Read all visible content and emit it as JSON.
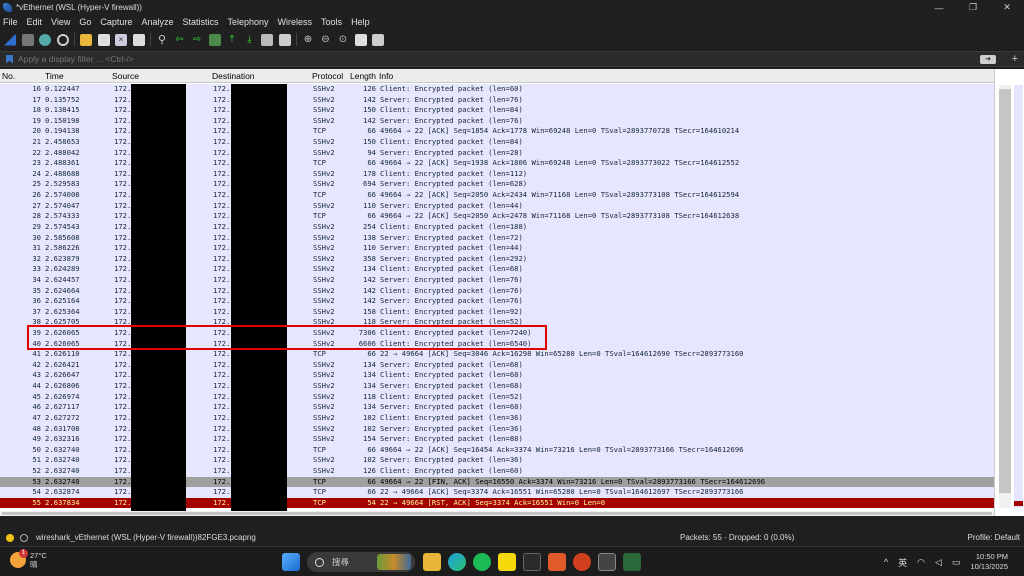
{
  "window": {
    "title": "*vEthernet (WSL (Hyper-V firewall))",
    "controls": [
      "—",
      "❐",
      "✕"
    ]
  },
  "menu": [
    "File",
    "Edit",
    "View",
    "Go",
    "Capture",
    "Analyze",
    "Statistics",
    "Telephony",
    "Wireless",
    "Tools",
    "Help"
  ],
  "filter": {
    "placeholder": "Apply a display filter ... <Ctrl-/>"
  },
  "columns": {
    "no": "No.",
    "time": "Time",
    "source": "Source",
    "destination": "Destination",
    "protocol": "Protocol",
    "length": "Length",
    "info": "Info"
  },
  "packets": [
    {
      "no": "16",
      "time": "0.122447",
      "src": "172.",
      "dst": "172.",
      "proto": "SSHv2",
      "len": "126",
      "info": "Client: Encrypted packet (len=60)"
    },
    {
      "no": "17",
      "time": "0.135752",
      "src": "172.",
      "dst": "172.",
      "proto": "SSHv2",
      "len": "142",
      "info": "Server: Encrypted packet (len=76)"
    },
    {
      "no": "18",
      "time": "0.138415",
      "src": "172.",
      "dst": "172.",
      "proto": "SSHv2",
      "len": "150",
      "info": "Client: Encrypted packet (len=84)"
    },
    {
      "no": "19",
      "time": "0.150198",
      "src": "172.",
      "dst": "172.",
      "proto": "SSHv2",
      "len": "142",
      "info": "Server: Encrypted packet (len=76)"
    },
    {
      "no": "20",
      "time": "0.194138",
      "src": "172.",
      "dst": "172.",
      "proto": "TCP",
      "len": "66",
      "info": "49664 → 22 [ACK] Seq=1854 Ack=1778 Win=69248 Len=0 TSval=2893770728 TSecr=164610214"
    },
    {
      "no": "21",
      "time": "2.458653",
      "src": "172.",
      "dst": "172.",
      "proto": "SSHv2",
      "len": "150",
      "info": "Client: Encrypted packet (len=84)"
    },
    {
      "no": "22",
      "time": "2.488042",
      "src": "172.",
      "dst": "172.",
      "proto": "SSHv2",
      "len": "94",
      "info": "Server: Encrypted packet (len=28)"
    },
    {
      "no": "23",
      "time": "2.488361",
      "src": "172.",
      "dst": "172.",
      "proto": "TCP",
      "len": "66",
      "info": "49664 → 22 [ACK] Seq=1938 Ack=1806 Win=69248 Len=0 TSval=2893773022 TSecr=164612552"
    },
    {
      "no": "24",
      "time": "2.488688",
      "src": "172.",
      "dst": "172.",
      "proto": "SSHv2",
      "len": "178",
      "info": "Client: Encrypted packet (len=112)"
    },
    {
      "no": "25",
      "time": "2.529583",
      "src": "172.",
      "dst": "172.",
      "proto": "SSHv2",
      "len": "694",
      "info": "Server: Encrypted packet (len=628)"
    },
    {
      "no": "26",
      "time": "2.574008",
      "src": "172.",
      "dst": "172.",
      "proto": "TCP",
      "len": "66",
      "info": "49664 → 22 [ACK] Seq=2050 Ack=2434 Win=71168 Len=0 TSval=2893773108 TSecr=164612594"
    },
    {
      "no": "27",
      "time": "2.574047",
      "src": "172.",
      "dst": "172.",
      "proto": "SSHv2",
      "len": "110",
      "info": "Server: Encrypted packet (len=44)"
    },
    {
      "no": "28",
      "time": "2.574333",
      "src": "172.",
      "dst": "172.",
      "proto": "TCP",
      "len": "66",
      "info": "49664 → 22 [ACK] Seq=2050 Ack=2478 Win=71168 Len=0 TSval=2893773108 TSecr=164612638"
    },
    {
      "no": "29",
      "time": "2.574543",
      "src": "172.",
      "dst": "172.",
      "proto": "SSHv2",
      "len": "254",
      "info": "Client: Encrypted packet (len=188)"
    },
    {
      "no": "30",
      "time": "2.585608",
      "src": "172.",
      "dst": "172.",
      "proto": "SSHv2",
      "len": "138",
      "info": "Server: Encrypted packet (len=72)"
    },
    {
      "no": "31",
      "time": "2.586226",
      "src": "172.",
      "dst": "172.",
      "proto": "SSHv2",
      "len": "110",
      "info": "Server: Encrypted packet (len=44)"
    },
    {
      "no": "32",
      "time": "2.623879",
      "src": "172.",
      "dst": "172.",
      "proto": "SSHv2",
      "len": "358",
      "info": "Server: Encrypted packet (len=292)"
    },
    {
      "no": "33",
      "time": "2.624289",
      "src": "172.",
      "dst": "172.",
      "proto": "SSHv2",
      "len": "134",
      "info": "Client: Encrypted packet (len=68)"
    },
    {
      "no": "34",
      "time": "2.624457",
      "src": "172.",
      "dst": "172.",
      "proto": "SSHv2",
      "len": "142",
      "info": "Server: Encrypted packet (len=76)"
    },
    {
      "no": "35",
      "time": "2.624664",
      "src": "172.",
      "dst": "172.",
      "proto": "SSHv2",
      "len": "142",
      "info": "Client: Encrypted packet (len=76)"
    },
    {
      "no": "36",
      "time": "2.625164",
      "src": "172.",
      "dst": "172.",
      "proto": "SSHv2",
      "len": "142",
      "info": "Server: Encrypted packet (len=76)"
    },
    {
      "no": "37",
      "time": "2.625364",
      "src": "172.",
      "dst": "172.",
      "proto": "SSHv2",
      "len": "158",
      "info": "Client: Encrypted packet (len=92)"
    },
    {
      "no": "38",
      "time": "2.625705",
      "src": "172.",
      "dst": "172.",
      "proto": "SSHv2",
      "len": "118",
      "info": "Server: Encrypted packet (len=52)"
    },
    {
      "no": "39",
      "time": "2.626065",
      "src": "172.",
      "dst": "172.",
      "proto": "SSHv2",
      "len": "7306",
      "info": "Client: Encrypted packet (len=7240)"
    },
    {
      "no": "40",
      "time": "2.626065",
      "src": "172.",
      "dst": "172.",
      "proto": "SSHv2",
      "len": "6606",
      "info": "Client: Encrypted packet (len=6540)"
    },
    {
      "no": "41",
      "time": "2.626110",
      "src": "172.",
      "dst": "172.",
      "proto": "TCP",
      "len": "66",
      "info": "22 → 49664 [ACK] Seq=3046 Ack=16298 Win=65280 Len=0 TSval=164612690 TSecr=2893773160"
    },
    {
      "no": "42",
      "time": "2.626421",
      "src": "172.",
      "dst": "172.",
      "proto": "SSHv2",
      "len": "134",
      "info": "Server: Encrypted packet (len=68)"
    },
    {
      "no": "43",
      "time": "2.626647",
      "src": "172.",
      "dst": "172.",
      "proto": "SSHv2",
      "len": "134",
      "info": "Client: Encrypted packet (len=68)"
    },
    {
      "no": "44",
      "time": "2.626806",
      "src": "172.",
      "dst": "172.",
      "proto": "SSHv2",
      "len": "134",
      "info": "Server: Encrypted packet (len=68)"
    },
    {
      "no": "45",
      "time": "2.626974",
      "src": "172.",
      "dst": "172.",
      "proto": "SSHv2",
      "len": "118",
      "info": "Client: Encrypted packet (len=52)"
    },
    {
      "no": "46",
      "time": "2.627117",
      "src": "172.",
      "dst": "172.",
      "proto": "SSHv2",
      "len": "134",
      "info": "Server: Encrypted packet (len=68)"
    },
    {
      "no": "47",
      "time": "2.627272",
      "src": "172.",
      "dst": "172.",
      "proto": "SSHv2",
      "len": "102",
      "info": "Client: Encrypted packet (len=36)"
    },
    {
      "no": "48",
      "time": "2.631708",
      "src": "172.",
      "dst": "172.",
      "proto": "SSHv2",
      "len": "102",
      "info": "Server: Encrypted packet (len=36)"
    },
    {
      "no": "49",
      "time": "2.632316",
      "src": "172.",
      "dst": "172.",
      "proto": "SSHv2",
      "len": "154",
      "info": "Server: Encrypted packet (len=88)"
    },
    {
      "no": "50",
      "time": "2.632740",
      "src": "172.",
      "dst": "172.",
      "proto": "TCP",
      "len": "66",
      "info": "49664 → 22 [ACK] Seq=16454 Ack=3374 Win=73216 Len=0 TSval=2893773166 TSecr=164612696"
    },
    {
      "no": "51",
      "time": "2.632740",
      "src": "172.",
      "dst": "172.",
      "proto": "SSHv2",
      "len": "102",
      "info": "Server: Encrypted packet (len=36)"
    },
    {
      "no": "52",
      "time": "2.632740",
      "src": "172.",
      "dst": "172.",
      "proto": "SSHv2",
      "len": "126",
      "info": "Client: Encrypted packet (len=60)"
    },
    {
      "no": "53",
      "time": "2.632740",
      "src": "172.",
      "dst": "172.",
      "proto": "TCP",
      "len": "66",
      "info": "49664 → 22 [FIN, ACK] Seq=16550 Ack=3374 Win=73216 Len=0 TSval=2893773166 TSecr=164612696",
      "state": "sel"
    },
    {
      "no": "54",
      "time": "2.632874",
      "src": "172.",
      "dst": "172.",
      "proto": "TCP",
      "len": "66",
      "info": "22 → 49664 [ACK] Seq=3374 Ack=16551 Win=65280 Len=0 TSval=164612697 TSecr=2893773166"
    },
    {
      "no": "55",
      "time": "2.637834",
      "src": "172.",
      "dst": "172.",
      "proto": "TCP",
      "len": "54",
      "info": "22 → 49664 [RST, ACK] Seq=3374 Ack=16551 Win=0 Len=0",
      "state": "rst"
    }
  ],
  "statusbar": {
    "file": "wireshark_vEthernet (WSL (Hyper-V firewall))82FGE3.pcapng",
    "packets": "Packets: 55 · Dropped: 0 (0.0%)",
    "profile": "Profile: Default"
  },
  "taskbar": {
    "weather": {
      "temp": "27°C",
      "cond": "晴",
      "badge": "1"
    },
    "search_label": "搜尋",
    "tray_ime": "英",
    "time": "10:50 PM",
    "date": "10/13/2025"
  },
  "colors": {
    "row_bg": "#e7e6ff",
    "row_selected": "#a0a0a0",
    "row_rst": "#a40000",
    "highlight_box": "#e00000"
  }
}
